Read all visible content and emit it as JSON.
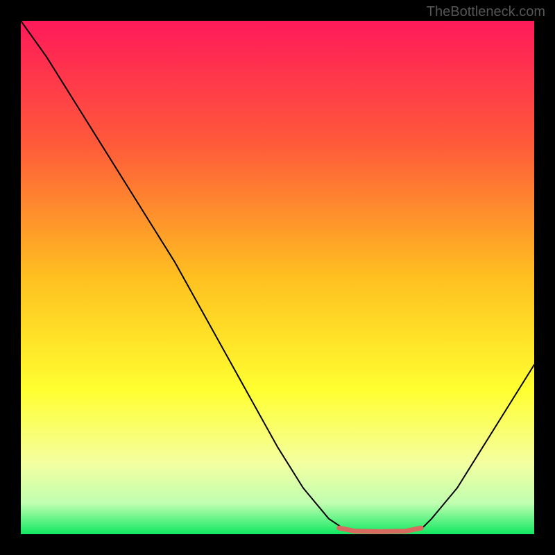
{
  "watermark": "TheBottleneck.com",
  "chart_data": {
    "type": "line",
    "title": "",
    "xlabel": "",
    "ylabel": "",
    "xlim": [
      0,
      100
    ],
    "ylim": [
      0,
      100
    ],
    "gradient_stops": [
      {
        "offset": 0,
        "color": "#ff1a5a"
      },
      {
        "offset": 24,
        "color": "#ff5a3a"
      },
      {
        "offset": 50,
        "color": "#ffc020"
      },
      {
        "offset": 72,
        "color": "#ffff30"
      },
      {
        "offset": 86,
        "color": "#f4ffa0"
      },
      {
        "offset": 94,
        "color": "#c0ffb0"
      },
      {
        "offset": 100,
        "color": "#10e860"
      }
    ],
    "series": [
      {
        "name": "bottleneck-curve",
        "color": "#000000",
        "width": 2,
        "x": [
          0,
          5,
          10,
          15,
          20,
          25,
          30,
          35,
          40,
          45,
          50,
          55,
          60,
          63,
          68,
          73,
          78,
          80,
          85,
          90,
          95,
          100
        ],
        "y": [
          100,
          93,
          85,
          77,
          69,
          61,
          53,
          44,
          35,
          26,
          17,
          9,
          3,
          1,
          0.5,
          0.5,
          1,
          3,
          9,
          17,
          25,
          33
        ]
      },
      {
        "name": "highlight-segment",
        "color": "#d86a60",
        "width": 7,
        "x": [
          62,
          65,
          70,
          75,
          78
        ],
        "y": [
          1.2,
          0.6,
          0.5,
          0.6,
          1.2
        ]
      }
    ]
  }
}
